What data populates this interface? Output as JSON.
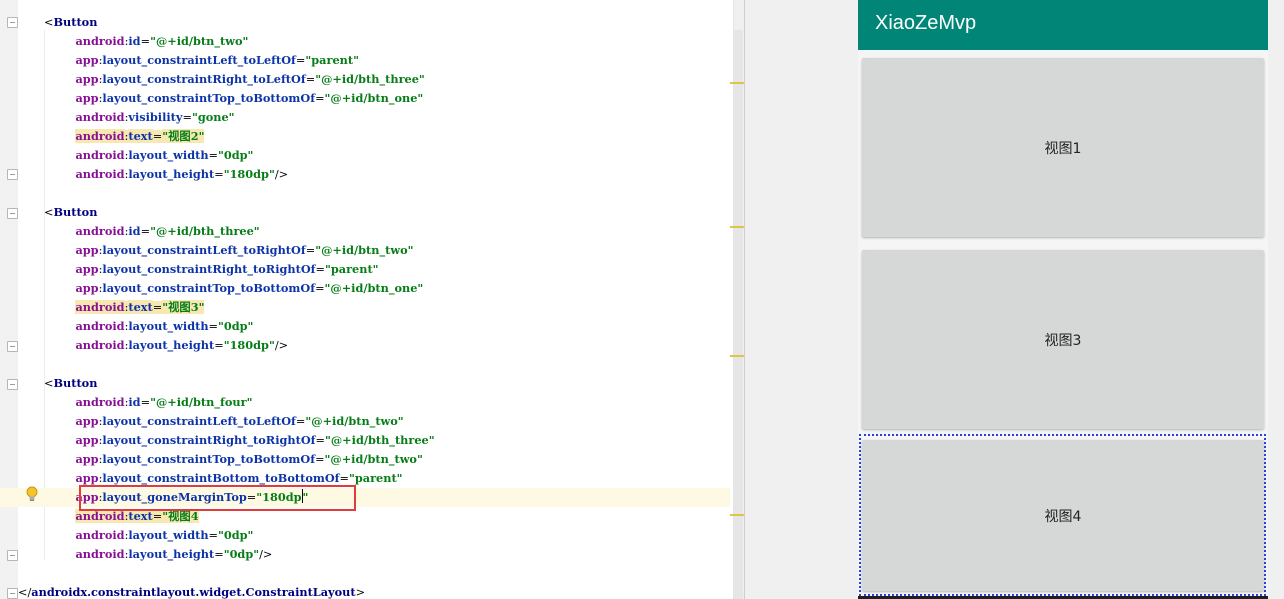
{
  "editor": {
    "lines": [
      [
        [
          "c-punc",
          "<"
        ],
        [
          "c-tag",
          "Button"
        ]
      ],
      [
        [
          "c-ns",
          "        android"
        ],
        [
          "c-punc",
          ":"
        ],
        [
          "c-attr",
          "id"
        ],
        [
          "c-punc",
          "="
        ],
        [
          "c-val",
          "\"@+id/btn_two\""
        ]
      ],
      [
        [
          "c-ns",
          "        app"
        ],
        [
          "c-punc",
          ":"
        ],
        [
          "c-attr",
          "layout_constraintLeft_toLeftOf"
        ],
        [
          "c-punc",
          "="
        ],
        [
          "c-val",
          "\"parent\""
        ]
      ],
      [
        [
          "c-ns",
          "        app"
        ],
        [
          "c-punc",
          ":"
        ],
        [
          "c-attr",
          "layout_constraintRight_toLeftOf"
        ],
        [
          "c-punc",
          "="
        ],
        [
          "c-val",
          "\"@+id/bth_three\""
        ]
      ],
      [
        [
          "c-ns",
          "        app"
        ],
        [
          "c-punc",
          ":"
        ],
        [
          "c-attr",
          "layout_constraintTop_toBottomOf"
        ],
        [
          "c-punc",
          "="
        ],
        [
          "c-val",
          "\"@+id/btn_one\""
        ]
      ],
      [
        [
          "c-ns",
          "        android"
        ],
        [
          "c-punc",
          ":"
        ],
        [
          "c-attr",
          "visibility"
        ],
        [
          "c-punc",
          "="
        ],
        [
          "c-val",
          "\"gone\""
        ]
      ],
      [
        [
          "c-ns",
          "        "
        ],
        [
          "c-ns hl",
          "android"
        ],
        [
          "c-punc hl",
          ":"
        ],
        [
          "c-attr hl",
          "text"
        ],
        [
          "c-punc hl",
          "="
        ],
        [
          "c-val hl",
          "\"视图2\""
        ]
      ],
      [
        [
          "c-ns",
          "        android"
        ],
        [
          "c-punc",
          ":"
        ],
        [
          "c-attr",
          "layout_width"
        ],
        [
          "c-punc",
          "="
        ],
        [
          "c-val",
          "\"0dp\""
        ]
      ],
      [
        [
          "c-ns",
          "        android"
        ],
        [
          "c-punc",
          ":"
        ],
        [
          "c-attr",
          "layout_height"
        ],
        [
          "c-punc",
          "="
        ],
        [
          "c-val",
          "\"180dp\""
        ],
        [
          "c-punc",
          "/>"
        ]
      ],
      [],
      [
        [
          "c-punc",
          "<"
        ],
        [
          "c-tag",
          "Button"
        ]
      ],
      [
        [
          "c-ns",
          "        android"
        ],
        [
          "c-punc",
          ":"
        ],
        [
          "c-attr",
          "id"
        ],
        [
          "c-punc",
          "="
        ],
        [
          "c-val",
          "\"@+id/bth_three\""
        ]
      ],
      [
        [
          "c-ns",
          "        app"
        ],
        [
          "c-punc",
          ":"
        ],
        [
          "c-attr",
          "layout_constraintLeft_toRightOf"
        ],
        [
          "c-punc",
          "="
        ],
        [
          "c-val",
          "\"@+id/btn_two\""
        ]
      ],
      [
        [
          "c-ns",
          "        app"
        ],
        [
          "c-punc",
          ":"
        ],
        [
          "c-attr",
          "layout_constraintRight_toRightOf"
        ],
        [
          "c-punc",
          "="
        ],
        [
          "c-val",
          "\"parent\""
        ]
      ],
      [
        [
          "c-ns",
          "        app"
        ],
        [
          "c-punc",
          ":"
        ],
        [
          "c-attr",
          "layout_constraintTop_toBottomOf"
        ],
        [
          "c-punc",
          "="
        ],
        [
          "c-val",
          "\"@+id/btn_one\""
        ]
      ],
      [
        [
          "c-ns",
          "        "
        ],
        [
          "c-ns hl",
          "android"
        ],
        [
          "c-punc hl",
          ":"
        ],
        [
          "c-attr hl",
          "text"
        ],
        [
          "c-punc hl",
          "="
        ],
        [
          "c-val hl",
          "\"视图3\""
        ]
      ],
      [
        [
          "c-ns",
          "        android"
        ],
        [
          "c-punc",
          ":"
        ],
        [
          "c-attr",
          "layout_width"
        ],
        [
          "c-punc",
          "="
        ],
        [
          "c-val",
          "\"0dp\""
        ]
      ],
      [
        [
          "c-ns",
          "        android"
        ],
        [
          "c-punc",
          ":"
        ],
        [
          "c-attr",
          "layout_height"
        ],
        [
          "c-punc",
          "="
        ],
        [
          "c-val",
          "\"180dp\""
        ],
        [
          "c-punc",
          "/>"
        ]
      ],
      [],
      [
        [
          "c-punc",
          "<"
        ],
        [
          "c-tag",
          "Button"
        ]
      ],
      [
        [
          "c-ns",
          "        android"
        ],
        [
          "c-punc",
          ":"
        ],
        [
          "c-attr",
          "id"
        ],
        [
          "c-punc",
          "="
        ],
        [
          "c-val",
          "\"@+id/btn_four\""
        ]
      ],
      [
        [
          "c-ns",
          "        app"
        ],
        [
          "c-punc",
          ":"
        ],
        [
          "c-attr",
          "layout_constraintLeft_toLeftOf"
        ],
        [
          "c-punc",
          "="
        ],
        [
          "c-val",
          "\"@+id/btn_two\""
        ]
      ],
      [
        [
          "c-ns",
          "        app"
        ],
        [
          "c-punc",
          ":"
        ],
        [
          "c-attr",
          "layout_constraintRight_toRightOf"
        ],
        [
          "c-punc",
          "="
        ],
        [
          "c-val",
          "\"@+id/bth_three\""
        ]
      ],
      [
        [
          "c-ns",
          "        app"
        ],
        [
          "c-punc",
          ":"
        ],
        [
          "c-attr",
          "layout_constraintTop_toBottomOf"
        ],
        [
          "c-punc",
          "="
        ],
        [
          "c-val",
          "\"@+id/btn_two\""
        ]
      ],
      [
        [
          "c-ns",
          "        app"
        ],
        [
          "c-punc",
          ":"
        ],
        [
          "c-attr",
          "layout_constraintBottom_toBottomOf"
        ],
        [
          "c-punc",
          "="
        ],
        [
          "c-val",
          "\"parent\""
        ]
      ],
      [
        [
          "c-ns",
          "        app"
        ],
        [
          "c-punc",
          ":"
        ],
        [
          "c-attr",
          "layout_goneMarginTop"
        ],
        [
          "c-punc",
          "="
        ],
        [
          "c-val",
          "\"180dp"
        ],
        [
          "cursor",
          ""
        ],
        [
          "c-val",
          "\""
        ]
      ],
      [
        [
          "c-ns",
          "        "
        ],
        [
          "c-ns hl",
          "android"
        ],
        [
          "c-punc hl",
          ":"
        ],
        [
          "c-attr hl",
          "text"
        ],
        [
          "c-punc hl",
          "="
        ],
        [
          "c-val hl",
          "\"视图4"
        ]
      ],
      [
        [
          "c-ns",
          "        android"
        ],
        [
          "c-punc",
          ":"
        ],
        [
          "c-attr",
          "layout_width"
        ],
        [
          "c-punc",
          "="
        ],
        [
          "c-val",
          "\"0dp\""
        ]
      ],
      [
        [
          "c-ns",
          "        android"
        ],
        [
          "c-punc",
          ":"
        ],
        [
          "c-attr",
          "layout_height"
        ],
        [
          "c-punc",
          "="
        ],
        [
          "c-val",
          "\"0dp\""
        ],
        [
          "c-punc",
          "/>"
        ]
      ],
      [],
      [
        [
          "c-punc",
          "</"
        ],
        [
          "c-tag",
          "androidx.constraintlayout.widget.ConstraintLayout"
        ],
        [
          "c-punc",
          ">"
        ]
      ]
    ]
  },
  "preview": {
    "app_title": "XiaoZeMvp",
    "buttons": [
      {
        "label": "视图1"
      },
      {
        "label": "视图3"
      },
      {
        "label": "视图4"
      }
    ]
  },
  "colors": {
    "app_bar": "#008577",
    "highlight_box": "#e23b3b",
    "selection_outline": "#2a43d6",
    "preview_button": "#d6d7d7"
  }
}
